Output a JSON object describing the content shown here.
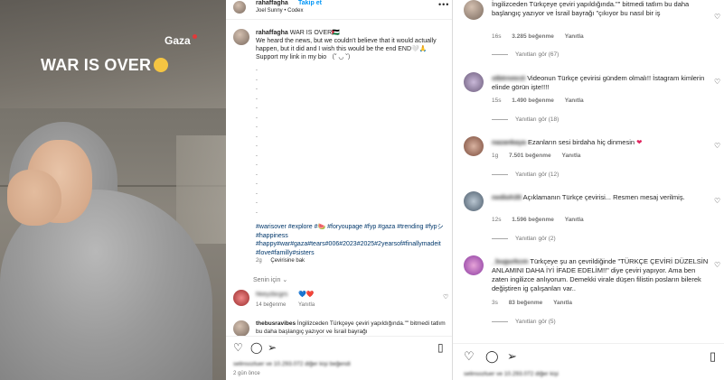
{
  "video": {
    "location_tag": "Gaza",
    "headline": "WAR IS OVER"
  },
  "post": {
    "username": "rahaffagha",
    "follow_label": "Takip et",
    "audio": "Joel Sunny • Codex",
    "more": "•••",
    "caption": {
      "username": "rahaffagha",
      "title": "WAR IS OVER🇵🇸",
      "body": "We heard the news, but we couldn't believe that it would actually happen, but it did and I wish this would be the end END🤍🙏 Support my link in my bio （˘ ◡ ˘）",
      "dots": [
        ".",
        ".",
        ".",
        ".",
        ".",
        ".",
        ".",
        ".",
        ".",
        ".",
        ".",
        ".",
        ".",
        ".",
        ".",
        "."
      ],
      "hashtags": "#warisover #explore #🍉 #foryoupage #fyp #gaza #trending #fypシ #happiness #happy#war#gaza#tears#006#2023#2025#2yearsof#finallymadeit #love#familly#sisters",
      "age": "2g",
      "translate_label": "Çevirisine bak"
    },
    "for_you_label": "Senin için",
    "comment1": {
      "name": "hkeyzbcgrs",
      "hearts": "💙❤️",
      "likes": "14 beğenme",
      "reply": "Yanıtla"
    },
    "comment2": {
      "name": "thebusravibes",
      "text": "İngilizceden Türkçeye çeviri yapıldığında.\"\" bitmedi tatlım bu daha başlangıç yazıyor ve İsrail bayrağı"
    },
    "likes_text": "selinsozluer ve 10.293.072 diğer kişi beğendi",
    "time_ago": "2 gün önce"
  },
  "comments": {
    "c1": {
      "text": "İngilizceden Türkçeye çeviri yapıldığında.\"\" bitmedi tatlım bu daha başlangıç yazıyor ve İsrail bayrağı \"çıkıyor bu nasıl bir iş",
      "age": "16s",
      "likes": "3.285 beğenme",
      "reply": "Yanıtla",
      "replies": "Yanıtları gör (67)"
    },
    "c2": {
      "name": "stbtrnmrzt",
      "text": "Videonun Türkçe çevirisi gündem olmalı!! İstagram kimlerin elinde görün işte!!!!",
      "age": "15s",
      "likes": "1.490 beğenme",
      "reply": "Yanıtla",
      "replies": "Yanıtları gör (18)"
    },
    "c3": {
      "name": "nazankaya",
      "text": "Ezanların sesi birdaha hiç dinmesin",
      "age": "1g",
      "likes": "7.501 beğenme",
      "reply": "Yanıtla",
      "replies": "Yanıtları gör (12)"
    },
    "c4": {
      "name": "nedioh35",
      "text": "Açıklamanın Türkçe çevirisi... Resmen mesaj verilmiş.",
      "age": "12s",
      "likes": "1.596 beğenme",
      "reply": "Yanıtla",
      "replies": "Yanıtları gör (2)"
    },
    "c5": {
      "name": "_bugurkcm",
      "text": "Türkçeye şu an çevrildiğinde \"TÜRKÇE ÇEVİRİ DÜZELSİN ANLAMINI DAHA İYİ İFADE EDELİM!!\" diye çeviri yapıyor. Ama ben zaten ingilizce anlıyorum. Demekki virale düşen filistin posların bilerek değiştiren ig çalışanları var..",
      "age": "3s",
      "likes": "83 beğenme",
      "reply": "Yanıtla",
      "replies": "Yanıtları gör (5)"
    },
    "likes_text": "selinsozluer ve 10.293.072 diğer kişi"
  }
}
